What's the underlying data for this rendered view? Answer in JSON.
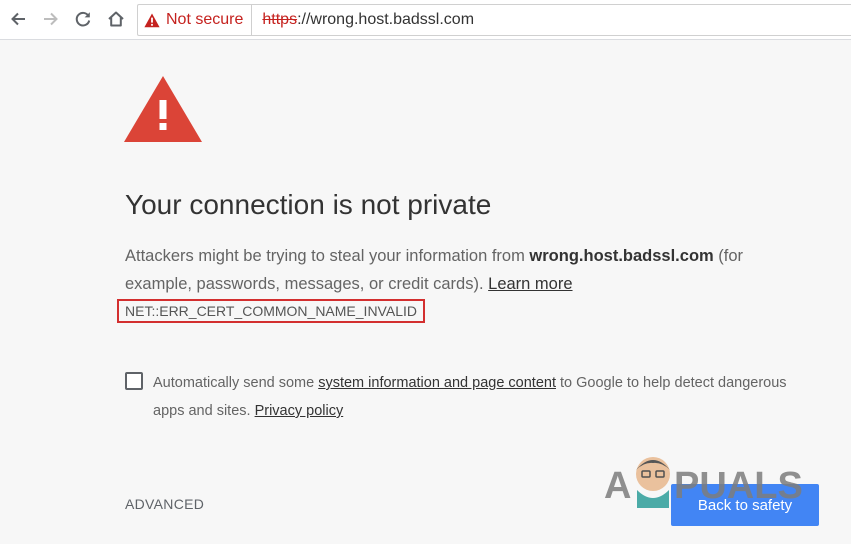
{
  "toolbar": {
    "security_label": "Not secure",
    "url_scheme": "https",
    "url_rest": "://wrong.host.badssl.com"
  },
  "interstitial": {
    "heading": "Your connection is not private",
    "explanation_prefix": "Attackers might be trying to steal your information from ",
    "host": "wrong.host.badssl.com",
    "explanation_suffix": " (for example, passwords, messages, or credit cards). ",
    "learn_more": "Learn more",
    "error_code": "NET::ERR_CERT_COMMON_NAME_INVALID",
    "checkbox_prefix": "Automatically send some ",
    "checkbox_link": "system information and page content",
    "checkbox_middle": " to Google to help detect dangerous apps and sites. ",
    "privacy_link": "Privacy policy",
    "advanced_label": "ADVANCED",
    "back_label": "Back to safety",
    "checkbox_checked": false
  },
  "watermark": {
    "text": "A PUALS"
  },
  "colors": {
    "danger": "#c5221f",
    "triangle": "#db4437",
    "primary_button": "#4285f4",
    "page_background": "#f7f7f7",
    "error_code_outline": "#d32f2f"
  },
  "icons": {
    "back": "arrow-left-icon",
    "forward": "arrow-right-icon",
    "reload": "reload-icon",
    "home": "home-icon",
    "security": "warning-triangle-icon",
    "page_warning": "warning-triangle-icon"
  }
}
